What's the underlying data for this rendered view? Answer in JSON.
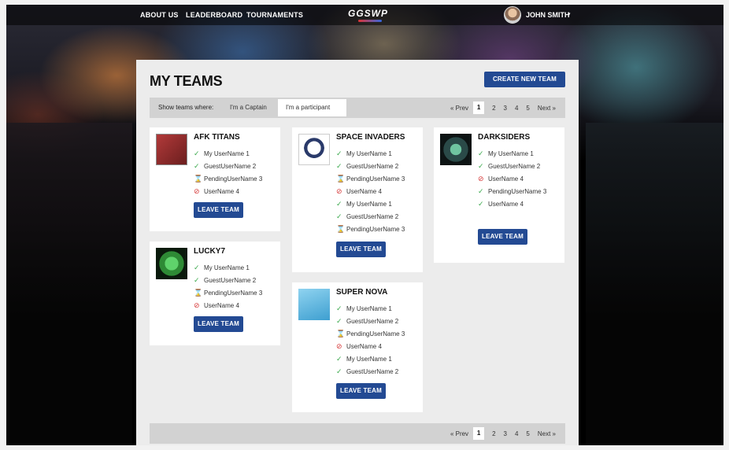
{
  "nav": {
    "links": [
      "ABOUT US",
      "LEADERBOARD",
      "TOURNAMENTS"
    ],
    "logo": "GGSWP",
    "user_name": "JOHN SMITH",
    "caret": "▾"
  },
  "page": {
    "title": "MY TEAMS",
    "create_button": "CREATE NEW TEAM",
    "filter_label": "Show teams where:",
    "filter_options": [
      "I'm a Captain",
      "I'm a participant"
    ],
    "active_filter": "I'm a participant"
  },
  "pagination": {
    "prev": "« Prev",
    "pages": [
      "1",
      "2",
      "3",
      "4",
      "5"
    ],
    "current": "1",
    "next": "Next »"
  },
  "leave_label": "LEAVE TEAM",
  "icons": {
    "ok": "✓",
    "pending": "⌛",
    "ban": "⊘"
  },
  "colors": {
    "accent": "#234a93",
    "ok": "#3aa94c",
    "pending": "#e8a21f",
    "ban": "#d63a3a"
  },
  "teams": [
    {
      "name": "AFK TITANS",
      "members": [
        {
          "status": "ok",
          "name": "My UserName 1"
        },
        {
          "status": "ok",
          "name": "GuestUserName 2"
        },
        {
          "status": "pending",
          "name": "PendingUserName 3"
        },
        {
          "status": "ban",
          "name": "UserName 4"
        }
      ]
    },
    {
      "name": "LUCKY7",
      "members": [
        {
          "status": "ok",
          "name": "My UserName 1"
        },
        {
          "status": "ok",
          "name": "GuestUserName 2"
        },
        {
          "status": "pending",
          "name": "PendingUserName 3"
        },
        {
          "status": "ban",
          "name": "UserName 4"
        }
      ]
    },
    {
      "name": "SPACE INVADERS",
      "members": [
        {
          "status": "ok",
          "name": "My UserName 1"
        },
        {
          "status": "ok",
          "name": "GuestUserName 2"
        },
        {
          "status": "pending",
          "name": "PendingUserName 3"
        },
        {
          "status": "ban",
          "name": "UserName 4"
        },
        {
          "status": "ok",
          "name": "My UserName 1"
        },
        {
          "status": "ok",
          "name": "GuestUserName 2"
        },
        {
          "status": "pending",
          "name": "PendingUserName 3"
        }
      ]
    },
    {
      "name": "SUPER NOVA",
      "members": [
        {
          "status": "ok",
          "name": "My UserName 1"
        },
        {
          "status": "ok",
          "name": "GuestUserName 2"
        },
        {
          "status": "pending",
          "name": "PendingUserName 3"
        },
        {
          "status": "ban",
          "name": "UserName 4"
        },
        {
          "status": "ok",
          "name": "My UserName 1"
        },
        {
          "status": "ok",
          "name": "GuestUserName 2"
        }
      ]
    },
    {
      "name": "DARKSIDERS",
      "members": [
        {
          "status": "ok",
          "name": "My UserName 1"
        },
        {
          "status": "ok",
          "name": "GuestUserName 2"
        },
        {
          "status": "ban",
          "name": "UserName 4"
        },
        {
          "status": "ok",
          "name": "PendingUserName 3"
        },
        {
          "status": "ok",
          "name": "UserName 4"
        }
      ]
    }
  ]
}
